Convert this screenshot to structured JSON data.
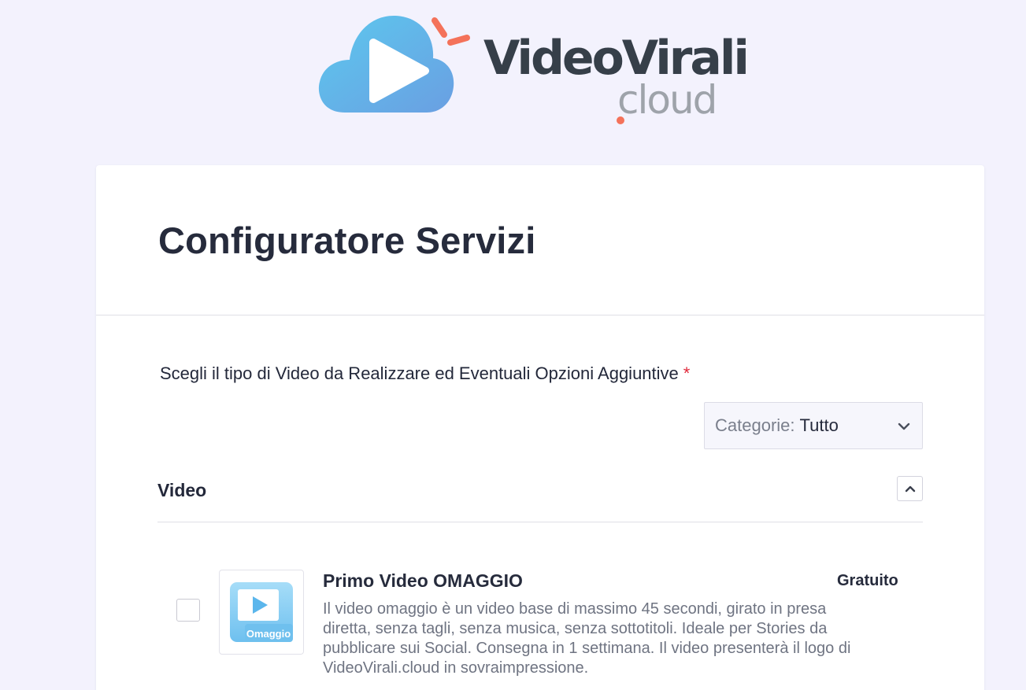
{
  "brand": {
    "name": "VideoVirali",
    "suffix": "cloud",
    "logo_icon": "play-cloud-icon",
    "colors": {
      "cloud": "#62b3e8",
      "accent": "#f4725a",
      "text": "#363f49",
      "suffix": "#9ea3aa"
    }
  },
  "page": {
    "title": "Configuratore Servizi"
  },
  "form": {
    "field_label": "Scegli il tipo di Video da Realizzare ed Eventuali Opzioni Aggiuntive",
    "required_mark": "*",
    "category_filter": {
      "prefix": "Categorie:",
      "value": "Tutto",
      "icon": "chevron-down-icon"
    }
  },
  "section": {
    "title": "Video",
    "collapse_icon": "chevron-up-icon",
    "items": [
      {
        "name": "Primo Video OMAGGIO",
        "price": "Gratuito",
        "thumb_label": "Omaggio",
        "checked": false,
        "description": "Il video omaggio è un video base di massimo 45 secondi, girato in presa diretta, senza tagli, senza musica, senza sottotitoli. Ideale per Stories da pubblicare sui Social. Consegna in 1 settimana. Il video presenterà il logo di VideoVirali.cloud in sovraimpressione."
      }
    ]
  }
}
